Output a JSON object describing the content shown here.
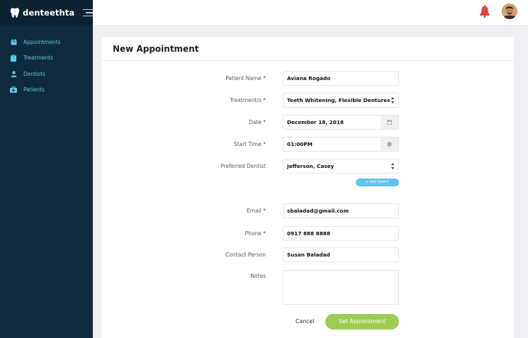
{
  "brand": {
    "name": "denteethta"
  },
  "sidebar": {
    "items": [
      {
        "label": "Appointments",
        "icon": "calendar-icon"
      },
      {
        "label": "Treatments",
        "icon": "clipboard-icon"
      },
      {
        "label": "Dentists",
        "icon": "person-icon"
      },
      {
        "label": "Patients",
        "icon": "medical-kit-icon"
      }
    ]
  },
  "colors": {
    "sidebar": "#0f2a3a",
    "accent": "#5ec6ec",
    "submit": "#9ccc52",
    "bell": "#e8413b"
  },
  "form": {
    "title": "New Appointment",
    "patient_name": {
      "label": "Patient Name *",
      "value": "Aviana Rogado"
    },
    "treatments": {
      "label": "Treatment/s *",
      "value": "Teeth Whitening, Flexible Dentures"
    },
    "date": {
      "label": "Date *",
      "value": "December 18, 2018"
    },
    "start_time": {
      "label": "Start Time *",
      "value": "01:00PM"
    },
    "dentist": {
      "label": "Preferred Dentist",
      "value": "Jefferson, Casey"
    },
    "add_patient_label": "+ Add Patient",
    "email": {
      "label": "Email *",
      "value": "sbaladad@gmail.com"
    },
    "phone": {
      "label": "Phone *",
      "value": "0917 888 8888"
    },
    "contact": {
      "label": "Contact Person",
      "value": "Susan Baladad"
    },
    "notes": {
      "label": "Notes",
      "value": ""
    },
    "cancel_label": "Cancel",
    "submit_label": "Set Appointment"
  }
}
